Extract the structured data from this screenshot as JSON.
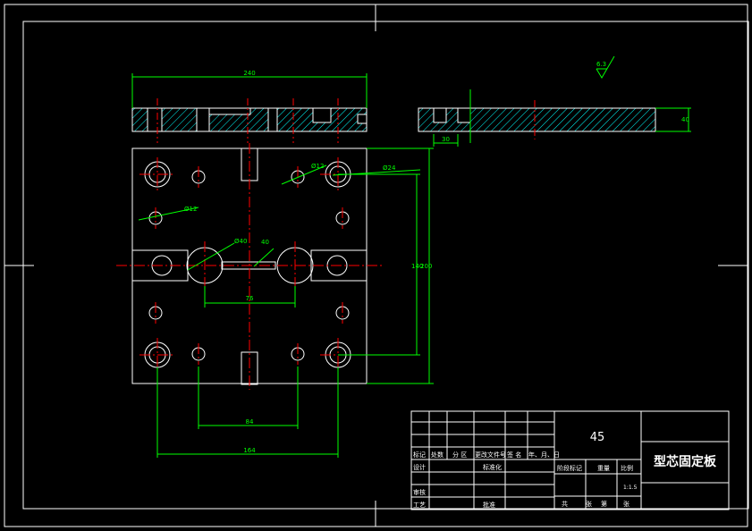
{
  "colors": {
    "background": "#000000",
    "outline": "#ffffff",
    "dimension": "#00ff00",
    "centerline": "#ff0000",
    "hatch": "#00ffff"
  },
  "dimensions": {
    "top_width": "240",
    "side_offset": "30",
    "side_height": "40",
    "right_height_inner": "140",
    "right_height_outer": "200",
    "bottom_inner": "84",
    "bottom_outer": "164",
    "center_span": "76",
    "dia_large": "Ø24",
    "dia_small": "Ø12",
    "dia_left": "Ø12",
    "dia_center": "Ø40",
    "roughness": "6.3",
    "small_label": "40"
  },
  "title_block": {
    "material": "45",
    "part_name": "型芯固定板",
    "scale": "1:1.5",
    "headers": [
      "标记",
      "处数",
      "分 区",
      "更改文件号",
      "签 名",
      "年、月、日"
    ],
    "row_design": "设计",
    "row_standard": "标准化",
    "row_review": "审核",
    "row_process": "工艺",
    "row_approve": "批准",
    "stage_mark": "阶段标记",
    "weight": "重量",
    "scale_label": "比例",
    "sheets_total": "共",
    "sheets_label": "张",
    "sheet_no": "第",
    "sheet_unit": "张"
  }
}
